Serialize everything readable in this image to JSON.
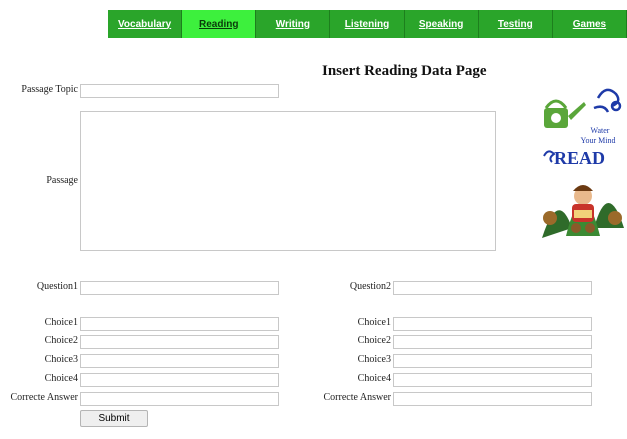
{
  "nav": {
    "items": [
      "Vocabulary",
      "Reading",
      "Writing",
      "Listening",
      "Speaking",
      "Testing",
      "Games"
    ],
    "active": "Reading"
  },
  "page_title": "Insert Reading Data Page",
  "form": {
    "passage_topic_label": "Passage Topic",
    "passage_label": "Passage",
    "question1_label": "Question1",
    "question2_label": "Question2",
    "left_choice_labels": [
      "Choice1",
      "Choice2",
      "Choice3",
      "Choice4",
      "Correcte Answer"
    ],
    "right_choice_labels": [
      "Choice1",
      "Choice2",
      "Choice3",
      "Choice4",
      "Correcte Answer"
    ],
    "submit_label": "Submit"
  },
  "logo": {
    "line1": "Water",
    "line2": "Your Mind",
    "line3": "READ"
  },
  "colors": {
    "nav_bg": "#2aa52a",
    "nav_active": "#3df03d",
    "logo_blue": "#1e3aa8",
    "logo_green": "#5aa63a"
  }
}
